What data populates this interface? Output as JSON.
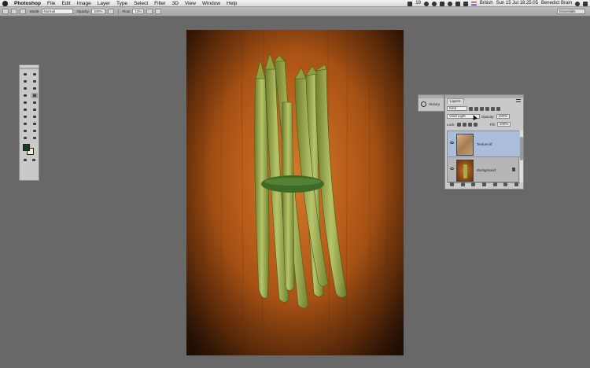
{
  "menubar": {
    "items": [
      "Photoshop",
      "File",
      "Edit",
      "Image",
      "Layer",
      "Type",
      "Select",
      "Filter",
      "3D",
      "View",
      "Window",
      "Help"
    ],
    "battery_count": "19",
    "input_source": "British",
    "clock": "Sun 15 Jul  18:25:05",
    "user": "Benedict Brain"
  },
  "options_bar": {
    "mode_label": "Mode:",
    "mode_value": "Normal",
    "opacity_label": "Opacity:",
    "opacity_value": "100%",
    "flow_label": "Flow:",
    "flow_value": "13%",
    "workspace": "Essentials"
  },
  "history_panel": {
    "label": "History"
  },
  "layers_panel": {
    "tab": "Layers",
    "kind_filter": "Kind",
    "blend_mode": "Vivid Light",
    "opacity_label": "Opacity:",
    "opacity_value": "100%",
    "lock_label": "Lock:",
    "fill_label": "Fill:",
    "fill_value": "100%",
    "layers": [
      {
        "name": "Texture.tif",
        "active": true
      },
      {
        "name": "Background",
        "active": false
      }
    ]
  },
  "colors": {
    "foreground": "#163d26",
    "background": "#f3ecd3",
    "selection": "#aabddb"
  }
}
